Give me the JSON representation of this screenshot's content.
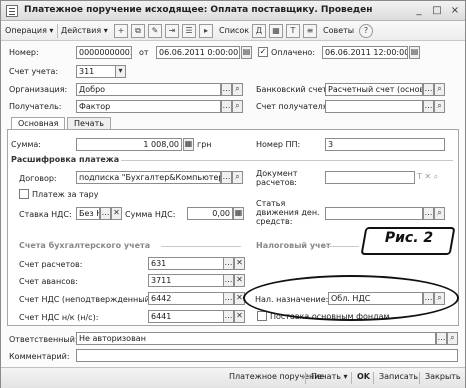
{
  "window": {
    "title": "Платежное поручение исходящее: Оплата поставщику. Проведен",
    "controls": [
      "_",
      "□",
      "×"
    ]
  },
  "toolbar": {
    "operation": "Операция ▾",
    "actions": "Действия ▾",
    "list": "Список",
    "advice": "Советы",
    "icons": [
      "add-icon",
      "copy-icon",
      "edit-icon",
      "post-icon",
      "structure-icon",
      "dt-kt-icon",
      "table-icon"
    ]
  },
  "header": {
    "number_label": "Номер:",
    "number_value": "00000000003",
    "date_from_label": "от",
    "date_value": "06.06.2011  0:00:00",
    "paid_label": "Оплачено:",
    "paid_checked": "✓",
    "paid_date_value": "06.06.2011 12:00:00",
    "account_label": "Счет учета:",
    "account_value": "311",
    "org_label": "Организация:",
    "org_value": "Добро",
    "bank_label": "Банковский счет:",
    "bank_value": "Расчетный счет (основной)",
    "recipient_label": "Получатель:",
    "recipient_value": "Фактор",
    "recipient_account_label": "Счет получателя:",
    "recipient_account_value": ""
  },
  "tabs": [
    {
      "label": "Основная",
      "active": true
    },
    {
      "label": "Печать",
      "active": false
    }
  ],
  "main": {
    "sum_label": "Сумма:",
    "sum_value": "1 008,00",
    "currency": "грн",
    "pp_label": "Номер ПП:",
    "pp_value": "3",
    "breakdown_title": "Расшифровка платежа",
    "contract_label": "Договор:",
    "contract_value": "подписка \"Бухгалтер&Компьютер\"",
    "document_label": "Документ расчетов:",
    "tare_label": "Платеж за тару",
    "vat_rate_label": "Ставка НДС:",
    "vat_rate_value": "Без Н",
    "vat_sum_label": "Сумма НДС:",
    "vat_sum_value": "0,00",
    "cash_flow_label": "Статья движения ден. средств:",
    "accounts_title": "Счета бухгалтерского учета",
    "tax_title": "Налоговый учет",
    "settlement_label": "Счет расчетов:",
    "settlement_value": "631",
    "advance_label": "Счет авансов:",
    "advance_value": "3711",
    "vat_unconfirmed_label": "Счет НДС (неподтвержденный):",
    "vat_unconfirmed_value": "6442",
    "vat_nn_label": "Счет НДС н/к (н/с):",
    "vat_nn_value": "6441",
    "tax_purpose_label": "Нал. назначение:",
    "tax_purpose_value": "Обл. НДС",
    "supply_label": "Поставка основным фондам"
  },
  "footer": {
    "responsible_label": "Ответственный:",
    "responsible_value": "Не авторизован",
    "comment_label": "Комментарий:",
    "comment_value": ""
  },
  "bottom": {
    "payment_order": "Платежное поручение",
    "print": "Печать ▾",
    "ok": "OK",
    "save": "Записать",
    "close": "Закрыть"
  },
  "annotation": {
    "label": "Рис. 2"
  }
}
